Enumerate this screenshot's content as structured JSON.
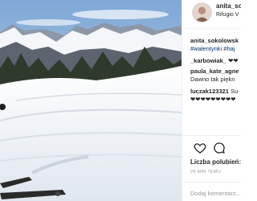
{
  "post": {
    "username": "anita_sokolowska",
    "location": "Rifugio Valparola",
    "username_display": "anita_so",
    "location_display": "Rifugio V"
  },
  "comments": [
    {
      "user": "anita_sokolowsk",
      "text": ""
    },
    {
      "user": "",
      "text": "#walentynki #haj"
    },
    {
      "user": "_karbowiak_",
      "text": "❤❤"
    },
    {
      "user": "paula_kate_agne",
      "text": ""
    },
    {
      "user": "",
      "text": "Dawno tak piękn"
    },
    {
      "user": "luczak123321",
      "text": "Su"
    },
    {
      "user": "",
      "text": "❤❤❤❤❤❤❤❤❤"
    }
  ],
  "actions": {
    "like_icon": "heart-icon",
    "comment_icon": "comment-icon"
  },
  "likes_label": "Liczba polubień:",
  "time_label": "28 MIN TEMU",
  "add_comment_placeholder": "Dodaj komentarz...",
  "colors": {
    "sky": "#aac7e6",
    "snow": "#f2f4f7",
    "hashtag": "#003569",
    "muted": "#999999"
  }
}
